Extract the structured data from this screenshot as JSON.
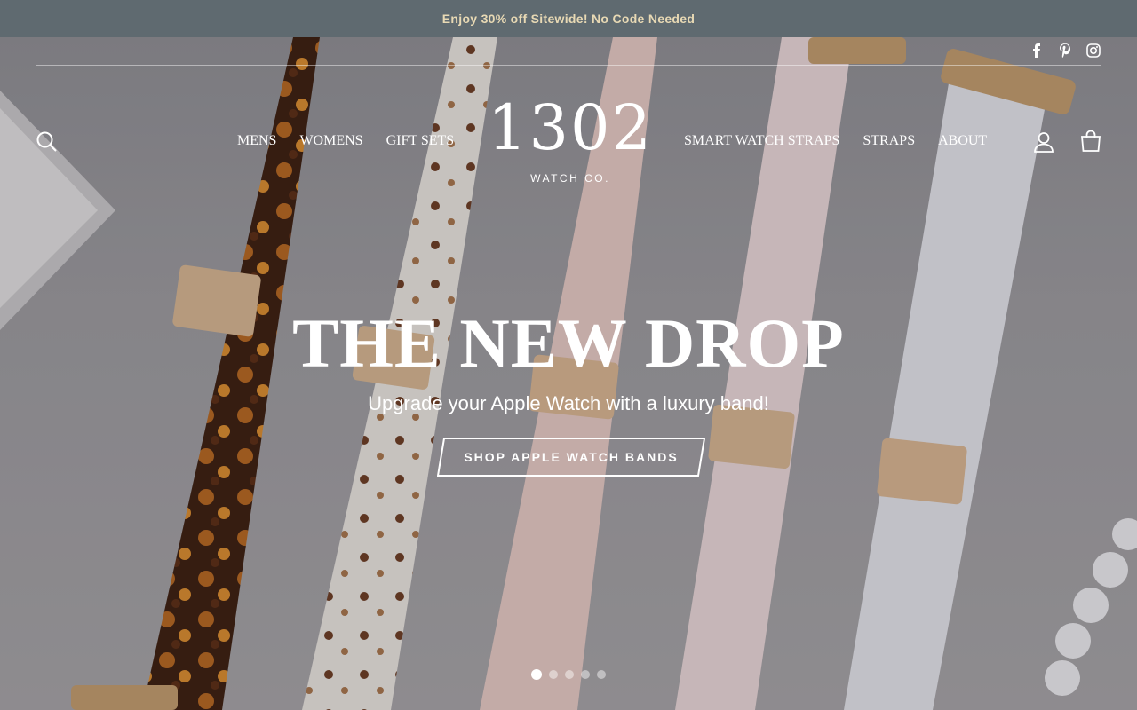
{
  "announcement": {
    "text": "Enjoy 30% off Sitewide! No Code Needed"
  },
  "social": [
    "facebook-icon",
    "pinterest-icon",
    "instagram-icon"
  ],
  "nav_left": [
    "MENS",
    "WOMENS",
    "GIFT SETS"
  ],
  "nav_right": [
    "SMART WATCH STRAPS",
    "STRAPS",
    "ABOUT"
  ],
  "logo": {
    "main": "1302",
    "sub": "WATCH CO."
  },
  "hero": {
    "headline": "THE NEW DROP",
    "subline": "Upgrade your Apple Watch with a luxury band!",
    "cta": "SHOP APPLE WATCH BANDS"
  },
  "slider": {
    "count": 5,
    "active": 1
  },
  "colors": {
    "announce_bg": "#5f6a70",
    "announce_text": "#e8d9b4",
    "text": "#ffffff"
  }
}
